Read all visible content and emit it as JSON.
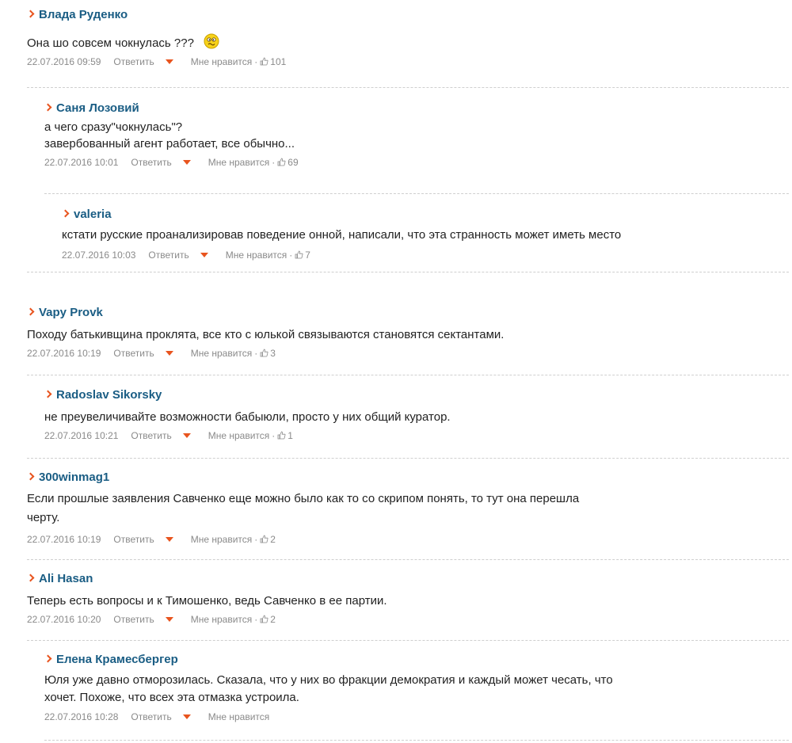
{
  "comments": [
    {
      "author": "Влада Руденко",
      "text": "Она шо совсем чокнулась ???",
      "date": "22.07.2016 09:59",
      "reply": "Ответить",
      "like_label": "Мне нравится",
      "sep": "·",
      "likes": "101"
    },
    {
      "author": "Саня Лозовий",
      "text": "а чего сразу\"чокнулась\"?\nзавербованный агент работает, все обычно...",
      "date": "22.07.2016 10:01",
      "reply": "Ответить",
      "like_label": "Мне нравится",
      "sep": "·",
      "likes": "69"
    },
    {
      "author": "valeria",
      "text": "кстати русские проанализировав поведение онной, написали, что эта странность может иметь место",
      "date": "22.07.2016 10:03",
      "reply": "Ответить",
      "like_label": "Мне нравится",
      "sep": "·",
      "likes": "7"
    },
    {
      "author": "Vapy Provk",
      "text": "Походу батькивщина проклята, все кто с юлькой связываются становятся сектантами.",
      "date": "22.07.2016 10:19",
      "reply": "Ответить",
      "like_label": "Мне нравится",
      "sep": "·",
      "likes": "3"
    },
    {
      "author": "Radoslav Sikorsky",
      "text": "не преувеличивайте возможности бабыюли, просто у них общий куратор.",
      "date": "22.07.2016 10:21",
      "reply": "Ответить",
      "like_label": "Мне нравится",
      "sep": "·",
      "likes": "1"
    },
    {
      "author": "300winmag1",
      "text": "Если прошлые заявления Савченко еще можно было как то со скрипом понять, то тут она перешла\nчерту.",
      "date": "22.07.2016 10:19",
      "reply": "Ответить",
      "like_label": "Мне нравится",
      "sep": "·",
      "likes": "2"
    },
    {
      "author": "Ali Hasan",
      "text": "Теперь есть вопросы и к Тимошенко, ведь Савченко в ее партии.",
      "date": "22.07.2016 10:20",
      "reply": "Ответить",
      "like_label": "Мне нравится",
      "sep": "·",
      "likes": "2"
    },
    {
      "author": "Елена Крамесбергер",
      "text": "Юля уже давно отморозилась. Сказала, что у них во фракции демократия и каждый может чесать, что\nхочет. Похоже, что всех эта отмазка устроила.",
      "date": "22.07.2016 10:28",
      "reply": "Ответить",
      "like_label": "Мне нравится"
    }
  ],
  "colors": {
    "author": "#1a5d84",
    "accent": "#e8541e",
    "meta": "#8a8a8a",
    "divider": "#cfcfcf"
  },
  "icons": {
    "chevron": "chevron-right-icon",
    "smiley": "confused-smiley-icon",
    "thumb": "thumbs-up-icon",
    "arrow": "dropdown-arrow-icon"
  }
}
